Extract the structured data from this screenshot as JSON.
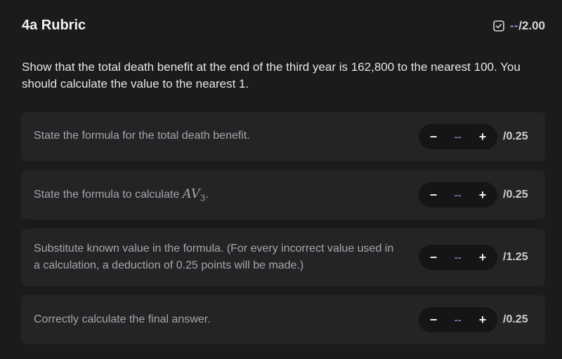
{
  "header": {
    "title": "4a Rubric",
    "score_value": "--",
    "score_total": "/2.00"
  },
  "question": "Show that the total death benefit at the end of the third year is 162,800 to the nearest 100. You should calculate the value to the nearest 1.",
  "criteria": [
    {
      "text": "State the formula for the total death benefit.",
      "value": "--",
      "max": "/0.25",
      "minus": "−",
      "plus": "+"
    },
    {
      "text_prefix": "State the formula to calculate ",
      "math_main": "AV",
      "math_sub": "3",
      "text_suffix": ".",
      "value": "--",
      "max": "/0.25",
      "minus": "−",
      "plus": "+"
    },
    {
      "text": "Substitute known value in the formula. (For every incorrect value used in a calculation, a deduction of 0.25 points will be made.)",
      "value": "--",
      "max": "/1.25",
      "minus": "−",
      "plus": "+"
    },
    {
      "text": "Correctly calculate the final answer.",
      "value": "--",
      "max": "/0.25",
      "minus": "−",
      "plus": "+"
    }
  ],
  "colors": {
    "background": "#1b1b1c",
    "card": "#242426",
    "accent": "#9e8fe0"
  }
}
